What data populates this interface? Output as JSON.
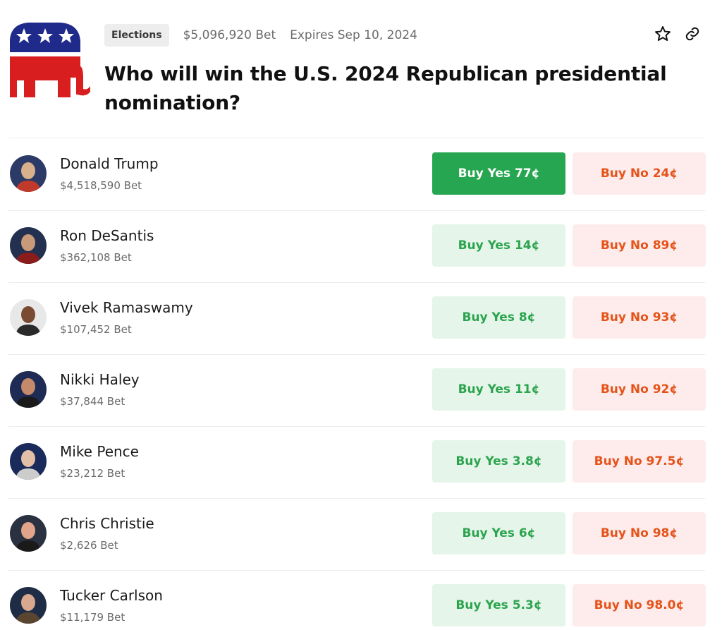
{
  "market": {
    "category": "Elections",
    "volume": "$5,096,920 Bet",
    "expires": "Expires Sep 10, 2024",
    "title": "Who will win the U.S. 2024 Republican presidential nomination?"
  },
  "colors": {
    "yes_active_bg": "#26a650",
    "yes_bg": "#e5f5ea",
    "yes_text": "#2ca44e",
    "no_bg": "#fdeceb",
    "no_text": "#e5531a",
    "logo_blue": "#1f2a8a",
    "logo_red": "#d81e1e"
  },
  "icons": {
    "favorite": "star-outline-icon",
    "share": "link-icon",
    "logo": "republican-elephant-logo"
  },
  "candidates": [
    {
      "name": "Donald Trump",
      "bet": "$4,518,590 Bet",
      "yes": "Buy Yes 77¢",
      "no": "Buy No 24¢",
      "yes_active": true
    },
    {
      "name": "Ron DeSantis",
      "bet": "$362,108 Bet",
      "yes": "Buy Yes 14¢",
      "no": "Buy No 89¢",
      "yes_active": false
    },
    {
      "name": "Vivek Ramaswamy",
      "bet": "$107,452 Bet",
      "yes": "Buy Yes 8¢",
      "no": "Buy No 93¢",
      "yes_active": false
    },
    {
      "name": "Nikki Haley",
      "bet": "$37,844 Bet",
      "yes": "Buy Yes 11¢",
      "no": "Buy No 92¢",
      "yes_active": false
    },
    {
      "name": "Mike Pence",
      "bet": "$23,212 Bet",
      "yes": "Buy Yes 3.8¢",
      "no": "Buy No 97.5¢",
      "yes_active": false
    },
    {
      "name": "Chris Christie",
      "bet": "$2,626 Bet",
      "yes": "Buy Yes 6¢",
      "no": "Buy No 98¢",
      "yes_active": false
    },
    {
      "name": "Tucker Carlson",
      "bet": "$11,179 Bet",
      "yes": "Buy Yes 5.3¢",
      "no": "Buy No 98.0¢",
      "yes_active": false
    }
  ]
}
